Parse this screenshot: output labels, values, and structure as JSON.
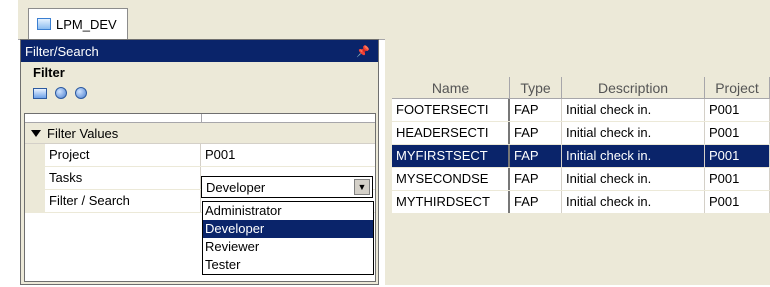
{
  "tab": {
    "label": "LPM_DEV",
    "icon": "folder-icon"
  },
  "filter_pane": {
    "title": "Filter/Search",
    "section_title": "Filter",
    "group_label": "Filter Values",
    "properties": [
      {
        "name": "Project",
        "value": "P001"
      },
      {
        "name": "Tasks",
        "value": "Developer"
      },
      {
        "name": "Filter / Search",
        "value": ""
      }
    ],
    "dropdown": {
      "options": [
        "Administrator",
        "Developer",
        "Reviewer",
        "Tester"
      ],
      "selected": "Developer"
    }
  },
  "results": {
    "columns": [
      "Name",
      "Type",
      "Description",
      "Project"
    ],
    "rows": [
      {
        "name": "FOOTERSECTI",
        "type": "FAP",
        "description": "Initial check in.",
        "project": "P001"
      },
      {
        "name": "HEADERSECTI",
        "type": "FAP",
        "description": "Initial check in.",
        "project": "P001"
      },
      {
        "name": "MYFIRSTSECT",
        "type": "FAP",
        "description": "Initial check in.",
        "project": "P001",
        "selected": true
      },
      {
        "name": "MYSECONDSE",
        "type": "FAP",
        "description": "Initial check in.",
        "project": "P001"
      },
      {
        "name": "MYTHIRDSECT",
        "type": "FAP",
        "description": "Initial check in.",
        "project": "P001"
      }
    ]
  },
  "colors": {
    "selection": "#0a246a",
    "panel": "#ece9d8"
  }
}
